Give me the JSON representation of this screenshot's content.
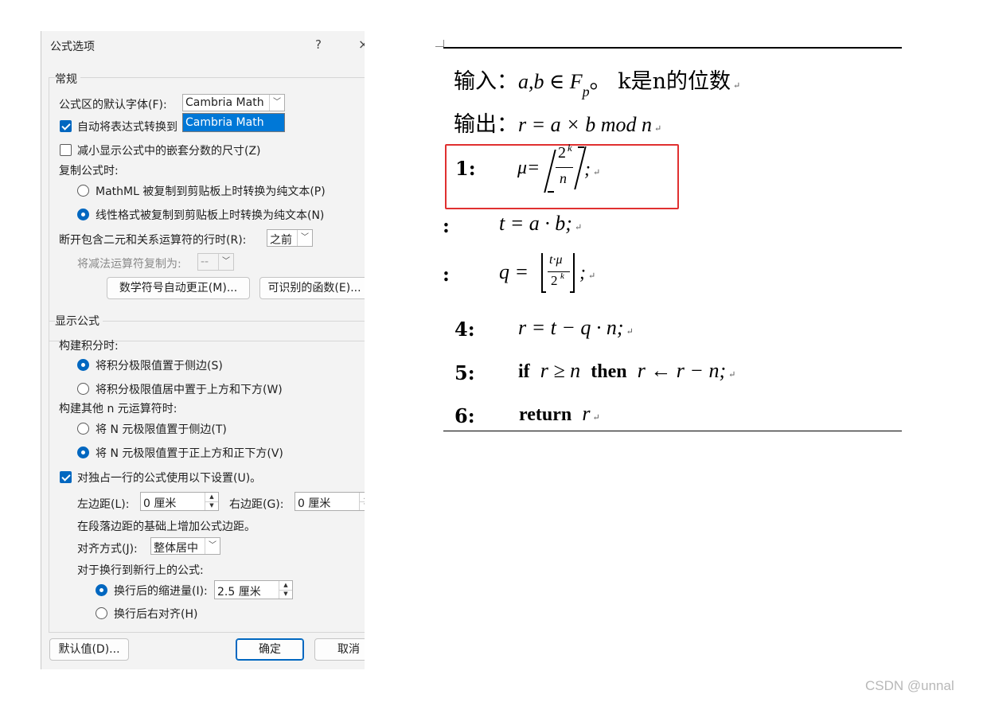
{
  "dialog": {
    "title": "公式选项",
    "help": "?",
    "close": "×",
    "general": {
      "heading": "常规",
      "default_font_label": "公式区的默认字体(F):",
      "default_font_value": "Cambria Math",
      "dropdown_option": "Cambria Math",
      "auto_convert_label": "自动将表达式转换到",
      "reduce_nested_label": "减小显示公式中的嵌套分数的尺寸(Z)",
      "copy_label": "复制公式时:",
      "copy_mathml_label": "MathML 被复制到剪贴板上时转换为纯文本(P)",
      "copy_linear_label": "线性格式被复制到剪贴板上时转换为纯文本(N)",
      "break_label": "断开包含二元和关系运算符的行时(R):",
      "break_value": "之前",
      "subtract_label": "将减法运算符复制为:",
      "subtract_value": "--",
      "autocorrect_button": "数学符号自动更正(M)...",
      "functions_button": "可识别的函数(E)..."
    },
    "display": {
      "heading": "显示公式",
      "integral_label": "构建积分时:",
      "integral_side": "将积分极限值置于侧边(S)",
      "integral_center": "将积分极限值居中置于上方和下方(W)",
      "nary_label": "构建其他 n 元运算符时:",
      "nary_side": "将 N 元极限值置于侧边(T)",
      "nary_center": "将 N 元极限值置于正上方和正下方(V)",
      "display_settings_label": "对独占一行的公式使用以下设置(U)。",
      "left_margin_label": "左边距(L):",
      "left_margin_value": "0 厘米",
      "right_margin_label": "右边距(G):",
      "right_margin_value": "0 厘米",
      "margin_note": "在段落边距的基础上增加公式边距。",
      "justify_label": "对齐方式(J):",
      "justify_value": "整体居中",
      "wrap_label": "对于换行到新行上的公式:",
      "wrap_indent_label": "换行后的缩进量(I):",
      "wrap_indent_value": "2.5 厘米",
      "wrap_right_label": "换行后右对齐(H)"
    },
    "footer": {
      "defaults_button": "默认值(D)...",
      "ok_button": "确定",
      "cancel_button": "取消"
    }
  },
  "document": {
    "input_label": "输入：",
    "input_math": "a,b ∈ F",
    "input_sub": "p",
    "input_rest": "。 k是n的位数",
    "output_label": "输出：",
    "output_math": "r = a × b mod n",
    "line1_num": "1:",
    "line1_lhs": "μ=",
    "line1_num_top": "2",
    "line1_sup": "k",
    "line1_den": "n",
    "line1_tail": ";",
    "line2_num": ":",
    "line2_math": "t  =  a  · b;",
    "line3_num": ":",
    "line3_lhs": "q =",
    "line3_top": "t·μ",
    "line3_bot": "2",
    "line3_sup": "k",
    "line3_tail": ";",
    "line4_num": "4:",
    "line4_math": "r  =  t  −  q  · n;",
    "line5_num": "5:",
    "line5_if": "if",
    "line5_cond": "r  ≥ n",
    "line5_then": "then",
    "line5_action": "r ← r  −  n;",
    "line6_num": "6:",
    "line6_return": "return",
    "line6_var": "r",
    "para_mark": "↵"
  },
  "watermark": "CSDN @unnal"
}
